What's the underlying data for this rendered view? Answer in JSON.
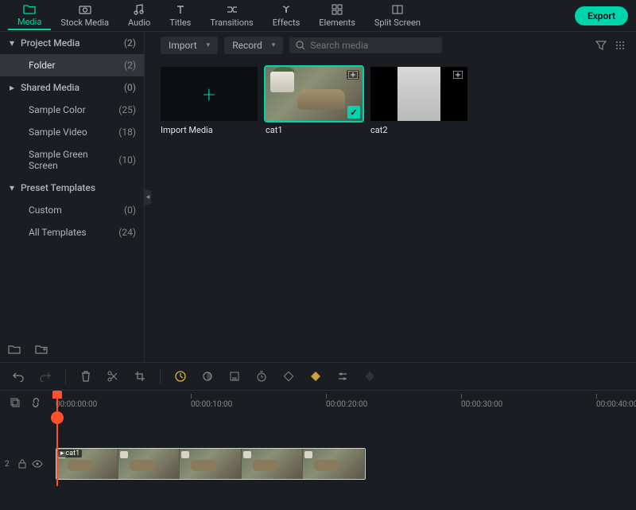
{
  "tabs": [
    {
      "label": "Media",
      "active": true
    },
    {
      "label": "Stock Media"
    },
    {
      "label": "Audio"
    },
    {
      "label": "Titles"
    },
    {
      "label": "Transitions"
    },
    {
      "label": "Effects"
    },
    {
      "label": "Elements"
    },
    {
      "label": "Split Screen"
    }
  ],
  "export_label": "Export",
  "sidebar": {
    "project_media": {
      "label": "Project Media",
      "count": "(2)"
    },
    "folder": {
      "label": "Folder",
      "count": "(2)"
    },
    "shared_media": {
      "label": "Shared Media",
      "count": "(0)"
    },
    "sample_color": {
      "label": "Sample Color",
      "count": "(25)"
    },
    "sample_video": {
      "label": "Sample Video",
      "count": "(18)"
    },
    "sample_green": {
      "label": "Sample Green Screen",
      "count": "(10)"
    },
    "preset_templates": {
      "label": "Preset Templates"
    },
    "custom": {
      "label": "Custom",
      "count": "(0)"
    },
    "all_templates": {
      "label": "All Templates",
      "count": "(24)"
    }
  },
  "content_toolbar": {
    "import_label": "Import",
    "record_label": "Record",
    "search_placeholder": "Search media"
  },
  "media": {
    "import_media": "Import Media",
    "cat1": "cat1",
    "cat2": "cat2"
  },
  "ruler": {
    "t0": "00:00:00:00",
    "t1": "00:00:10:00",
    "t2": "00:00:20:00",
    "t3": "00:00:30:00",
    "t4": "00:00:40:00"
  },
  "track": {
    "label": "2",
    "clip_label": "cat1"
  }
}
